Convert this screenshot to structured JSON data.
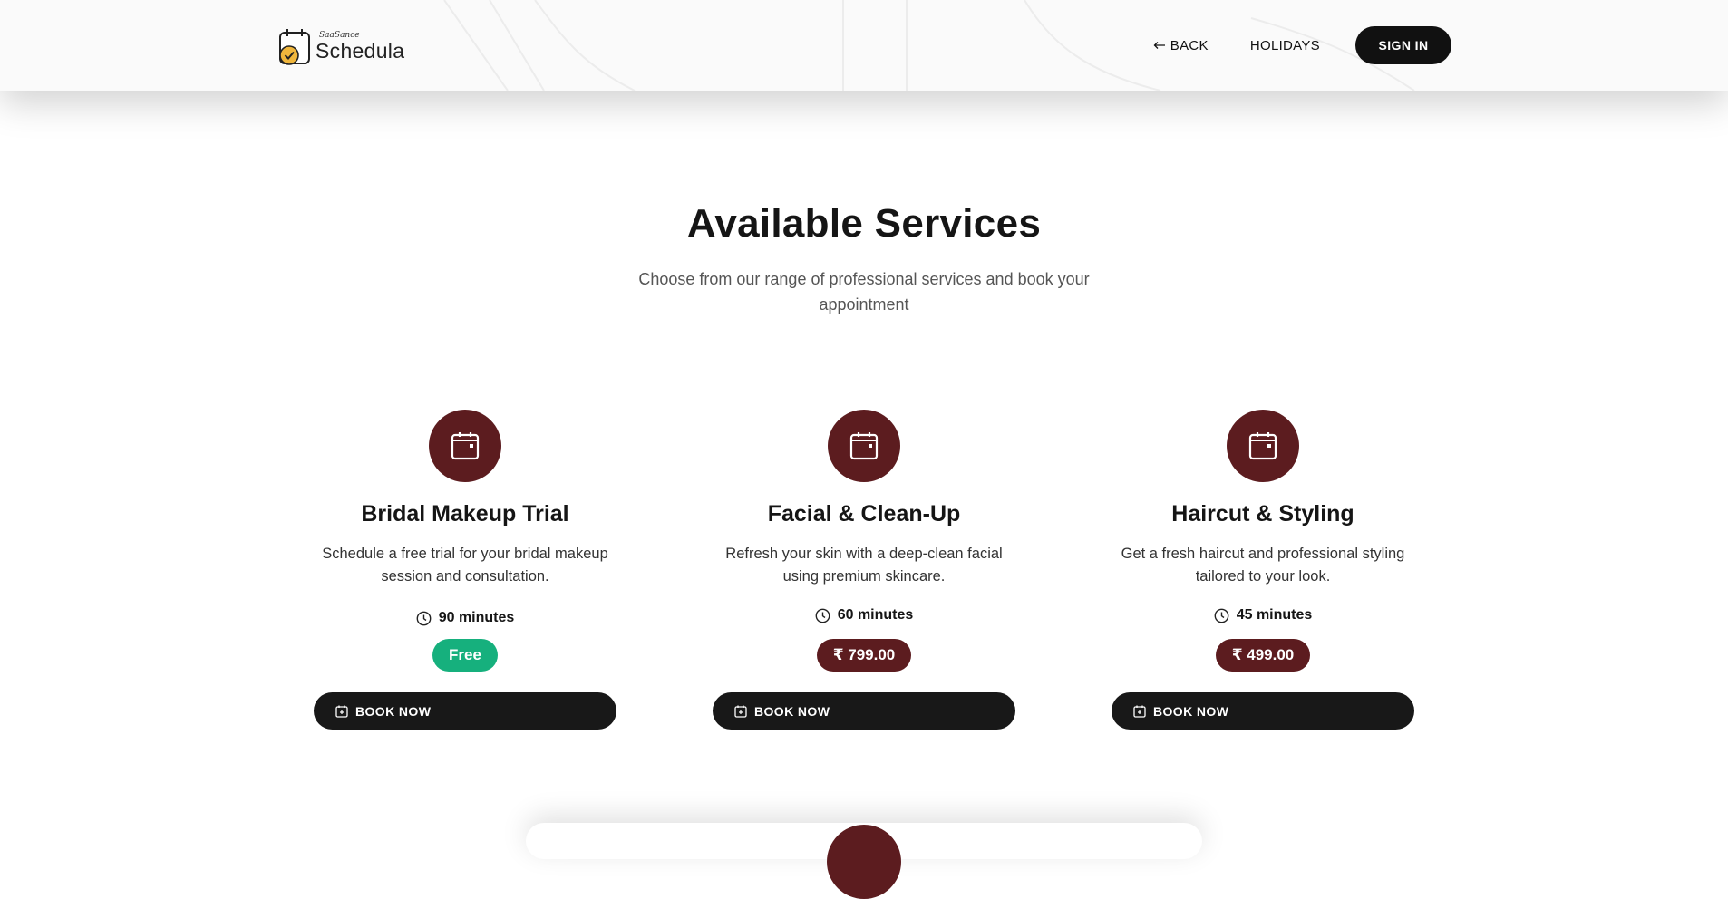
{
  "header": {
    "logo_small": "SaaSance",
    "logo_big": "Schedula",
    "nav": {
      "back": "BACK",
      "holidays": "HOLIDAYS",
      "signin": "SIGN IN"
    }
  },
  "hero": {
    "title": "Available Services",
    "subtitle": "Choose from our range of professional services and book your appointment"
  },
  "services": [
    {
      "title": "Bridal Makeup Trial",
      "description": "Schedule a free trial for your bridal makeup session and consultation.",
      "duration": "90 minutes",
      "price": "Free",
      "button": "BOOK NOW"
    },
    {
      "title": "Facial & Clean-Up",
      "description": "Refresh your skin with a deep-clean facial using premium skincare.",
      "duration": "60 minutes",
      "price": "₹ 799.00",
      "button": "BOOK NOW"
    },
    {
      "title": "Haircut & Styling",
      "description": "Get a fresh haircut and professional styling tailored to your look.",
      "duration": "45 minutes",
      "price": "₹ 499.00",
      "button": "BOOK NOW"
    }
  ],
  "icons": {
    "service": "calendar-icon",
    "duration": "clock-icon",
    "book": "calendar-plus-icon",
    "back": "arrow-left-icon",
    "logo": "calendar-check-icon"
  },
  "colors": {
    "accent": "#5c1c1f",
    "free_badge": "#16b07d",
    "button_dark": "#181818"
  }
}
